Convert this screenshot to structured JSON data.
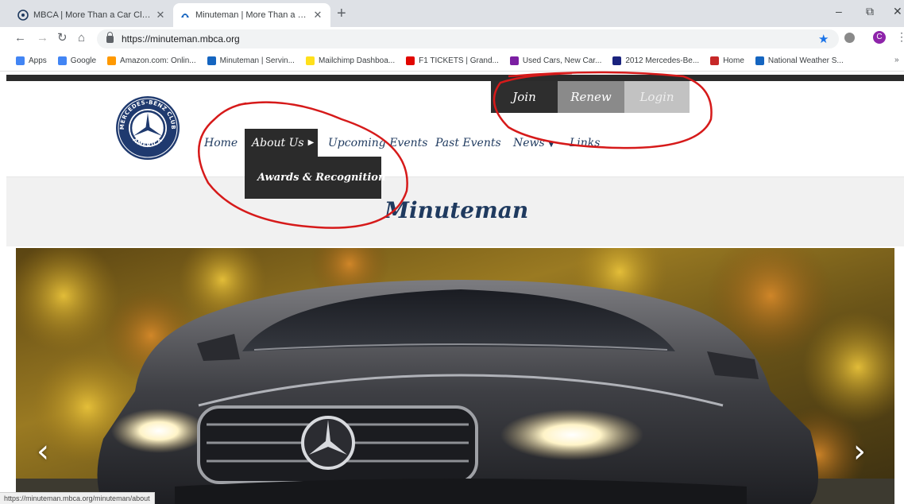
{
  "browser": {
    "tabs": [
      {
        "title": "MBCA | More Than a Car Club | W",
        "active": false
      },
      {
        "title": "Minuteman | More Than a Car Cl",
        "active": true
      }
    ],
    "new_tab_label": "+",
    "window_controls": {
      "minimize": "–",
      "maximize": "⧉",
      "close": "✕"
    },
    "url": "https://minuteman.mbca.org",
    "bookmarks": [
      {
        "label": "Apps",
        "icon": "apps-grid-icon",
        "color": "#4285f4"
      },
      {
        "label": "Google",
        "icon": "google-icon",
        "color": "#4285f4"
      },
      {
        "label": "Amazon.com: Onlin...",
        "icon": "amazon-icon",
        "color": "#ff9900"
      },
      {
        "label": "Minuteman | Servin...",
        "icon": "mbca-icon",
        "color": "#1565c0"
      },
      {
        "label": "Mailchimp Dashboa...",
        "icon": "mailchimp-icon",
        "color": "#ffe01b"
      },
      {
        "label": "F1 TICKETS | Grand...",
        "icon": "f1-icon",
        "color": "#e10600"
      },
      {
        "label": "Used Cars, New Car...",
        "icon": "cars-icon",
        "color": "#7b1fa2"
      },
      {
        "label": "2012 Mercedes-Be...",
        "icon": "mercedes-icon",
        "color": "#1a237e"
      },
      {
        "label": "Home",
        "icon": "home-icon",
        "color": "#c62828"
      },
      {
        "label": "National Weather S...",
        "icon": "weather-icon",
        "color": "#1565c0"
      }
    ],
    "bookmarks_more": "»",
    "profile_initial": "C",
    "status_url": "https://minuteman.mbca.org/minuteman/about"
  },
  "site": {
    "logo_text_top": "MERCEDES-BENZ CLUB",
    "logo_text_bottom": "AMERICA",
    "utility": {
      "join": "Join",
      "renew": "Renew",
      "login": "Login"
    },
    "nav": {
      "home": "Home",
      "about": "About Us",
      "upcoming": "Upcoming Events",
      "past": "Past Events",
      "news": "News",
      "links": "Links"
    },
    "dropdown_item": "Awards & Recognition",
    "page_title": "Minuteman",
    "slider": {
      "prev": "‹",
      "next": "›"
    }
  },
  "colors": {
    "nav_text": "#1f3a5f",
    "dark": "#2b2b2b",
    "annotation": "#d61a1a"
  }
}
